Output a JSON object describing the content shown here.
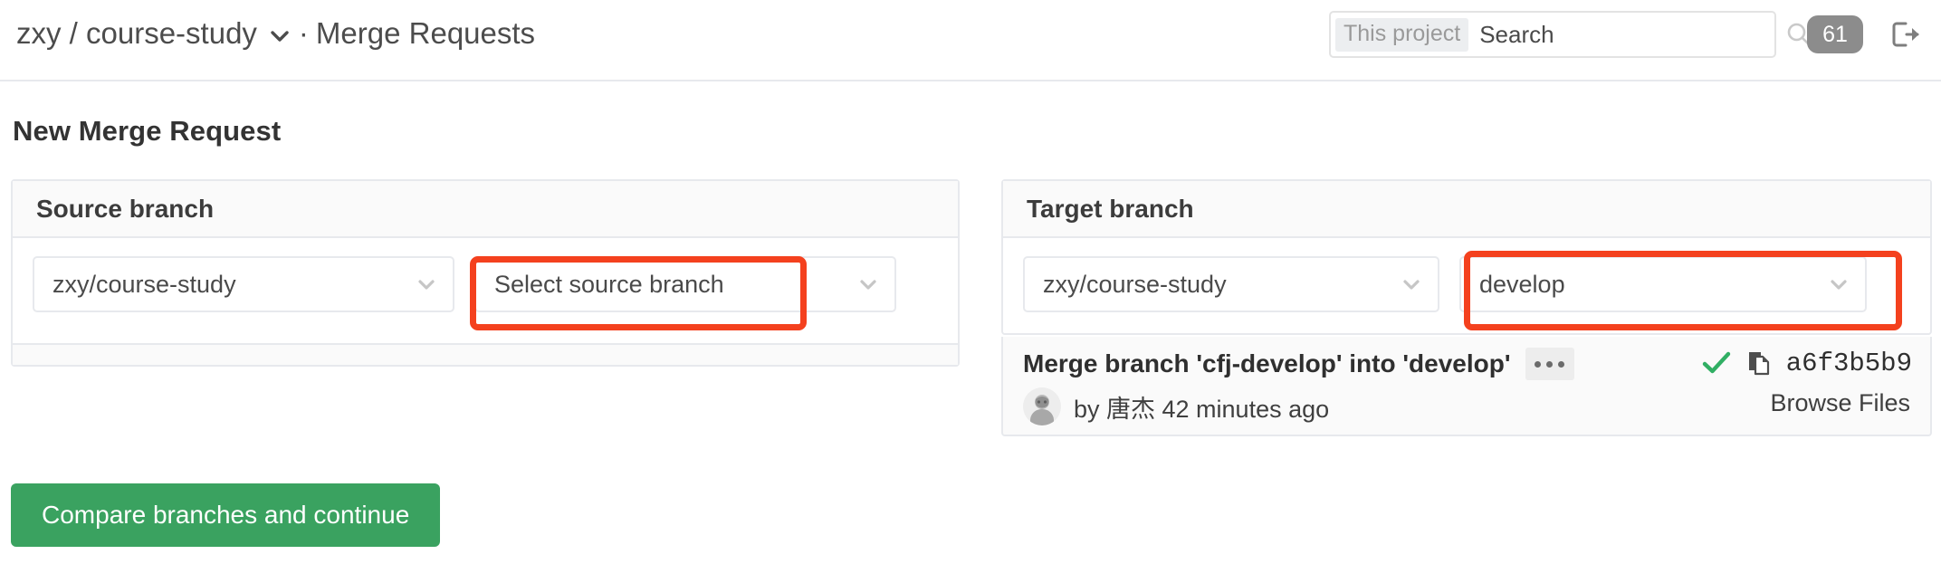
{
  "navbar": {
    "breadcrumb": {
      "namespace": "zxy",
      "slash": "/",
      "project": "course-study",
      "separator": "·",
      "page": "Merge Requests",
      "full": "zxy / course-study"
    },
    "search": {
      "scope_label": "This project",
      "placeholder": "Search",
      "value": "",
      "icon": "search-icon"
    },
    "todos_badge": "61",
    "signout_icon": "sign-out-icon"
  },
  "main": {
    "title": "New Merge Request",
    "source_panel": {
      "heading": "Source branch",
      "project_select": {
        "value": "zxy/course-study",
        "icon": "chevron-down-icon"
      },
      "branch_select": {
        "value": "Select source branch",
        "is_placeholder": true,
        "icon": "chevron-down-icon",
        "highlighted": true
      }
    },
    "target_panel": {
      "heading": "Target branch",
      "project_select": {
        "value": "zxy/course-study",
        "icon": "chevron-down-icon"
      },
      "branch_select": {
        "value": "develop",
        "is_placeholder": false,
        "icon": "chevron-down-icon",
        "highlighted": true
      },
      "commit": {
        "message": "Merge branch 'cfj-develop' into 'develop'",
        "expand_label": "...",
        "author_prefix": "by",
        "author": "唐杰",
        "time_ago": "42 minutes ago",
        "by_line": "by 唐杰 42 minutes ago",
        "status_icon": "check-icon",
        "copy_icon": "copy-to-clipboard-icon",
        "sha": "a6f3b5b9",
        "browse_files_label": "Browse Files"
      }
    },
    "submit_button": "Compare branches and continue"
  },
  "colors": {
    "accent_green": "#3aa260",
    "annotation_red": "#f4411e",
    "badge_gray": "#8c8c8c",
    "panel_border": "#e7e9ed",
    "panel_header_bg": "#fafafa",
    "status_green": "#31af64"
  }
}
